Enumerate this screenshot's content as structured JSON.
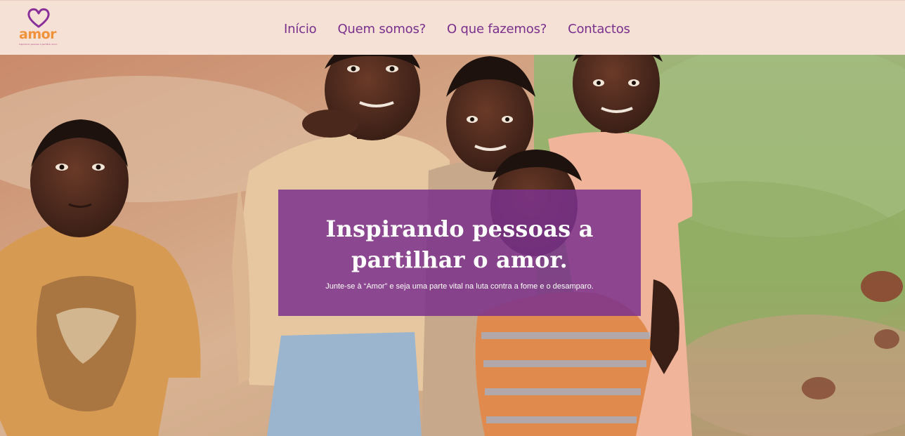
{
  "header": {
    "logo": {
      "word": "amor",
      "tagline": "Inspirando pessoas a partilhar amor."
    },
    "nav": [
      {
        "label": "Início"
      },
      {
        "label": "Quem somos?"
      },
      {
        "label": "O que fazemos?"
      },
      {
        "label": "Contactos"
      }
    ]
  },
  "hero": {
    "image": "photo of five smiling children outdoors",
    "title": "Inspirando pessoas a partilhar o amor.",
    "subtitle": "Junte-se à “Amor” e seja uma parte vital na luta contra a fome e o desamparo."
  },
  "colors": {
    "header_bg": "#f6e1d6",
    "nav_text": "#7a2f8d",
    "logo_orange": "#f0923a",
    "logo_purple": "#8a2f9a",
    "overlay": "#7b328c"
  }
}
